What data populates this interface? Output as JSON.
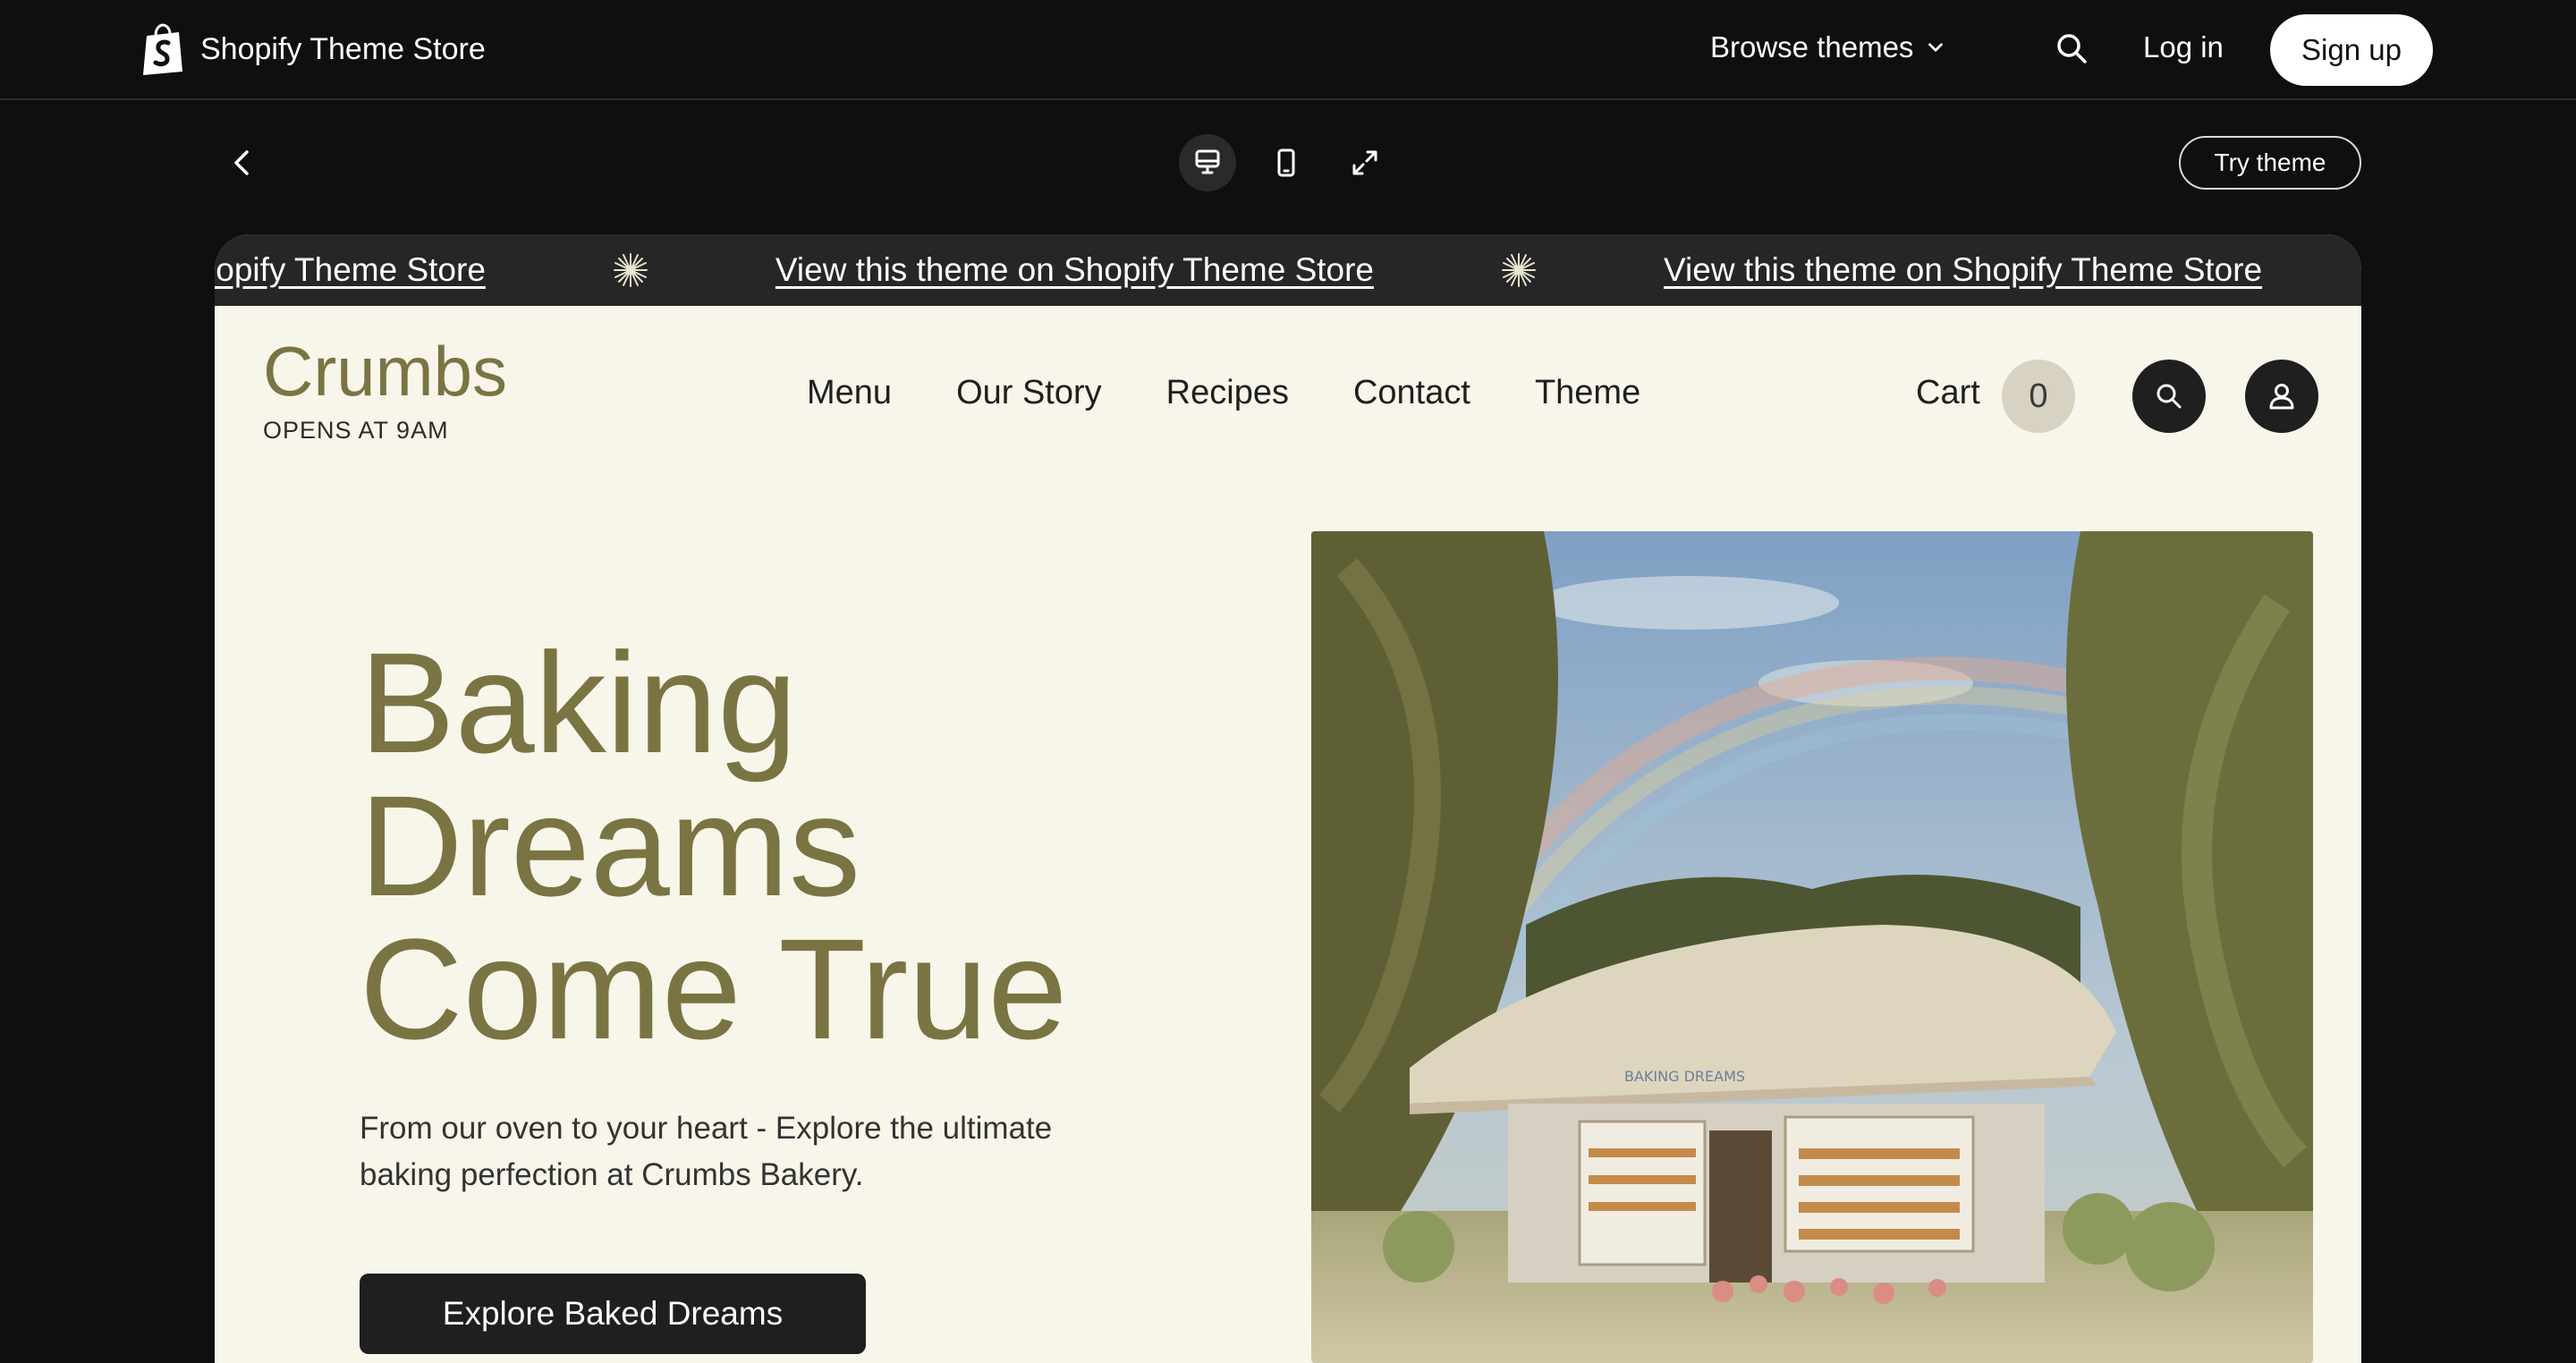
{
  "topbar": {
    "brand": "Shopify Theme Store",
    "browse_label": "Browse themes",
    "login_label": "Log in",
    "signup_label": "Sign up"
  },
  "toolbar": {
    "try_label": "Try theme",
    "devices": [
      "desktop-icon",
      "mobile-icon",
      "fullscreen-icon"
    ]
  },
  "marquee": {
    "items": [
      "Shopify Theme Store",
      "View this theme on Shopify Theme Store",
      "View this theme on Shopify Theme Store"
    ]
  },
  "store": {
    "name": "Crumbs",
    "tagline": "OPENS AT 9AM",
    "nav": [
      "Menu",
      "Our Story",
      "Recipes",
      "Contact",
      "Theme"
    ],
    "cart_label": "Cart",
    "cart_count": "0"
  },
  "hero": {
    "title_lines": [
      "Baking",
      "Dreams",
      "Come True"
    ],
    "subtitle": "From our oven to your heart - Explore the ultimate baking perfection at Crumbs Bakery.",
    "cta": "Explore Baked Dreams",
    "sign_text": "BAKING DREAMS"
  },
  "colors": {
    "page_bg": "#0f0f10",
    "store_bg": "#f8f5ea",
    "olive": "#7a7443",
    "dark": "#1f1f1f",
    "cart_badge": "#d8d2c3"
  }
}
